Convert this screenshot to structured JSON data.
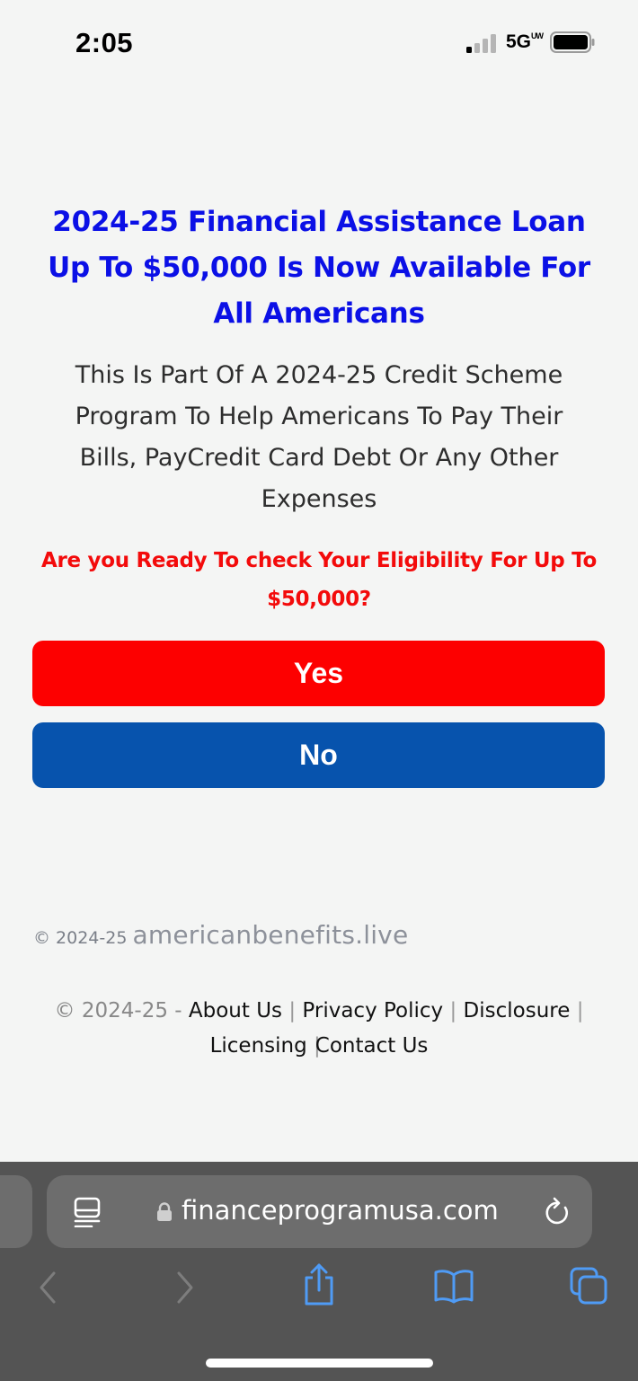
{
  "status_bar": {
    "time": "2:05",
    "network": "5G",
    "network_sup": "UW"
  },
  "main": {
    "headline": "2024-25 Financial Assistance Loan Up To $50,000 Is Now Available For All Americans",
    "subtext": "This Is Part Of A 2024-25 Credit Scheme Program To Help Americans To Pay Their Bills,  PayCredit Card Debt Or Any Other Expenses",
    "question": "Are you Ready To check Your Eligibility For Up To $50,000?",
    "yes_label": "Yes",
    "no_label": "No"
  },
  "footer": {
    "brand_prefix": "© 2024-25",
    "brand_domain": "americanbenefits.live",
    "links_prefix": "© 2024-25 -",
    "links": [
      "About Us",
      "Privacy Policy",
      "Disclosure",
      "Licensing",
      "Contact Us"
    ],
    "separator": "|"
  },
  "browser": {
    "url": "financeprogramusa.com",
    "icons": [
      "reader-icon",
      "lock-icon",
      "reload-icon",
      "back-icon",
      "forward-icon",
      "share-icon",
      "bookmarks-icon",
      "tabs-icon"
    ]
  },
  "colors": {
    "headline": "#0b10e6",
    "question": "#f30b0b",
    "yes_button": "#fd0000",
    "no_button": "#0753ad",
    "toolbar": "#545454",
    "accent_icons": "#4f9bf5"
  }
}
